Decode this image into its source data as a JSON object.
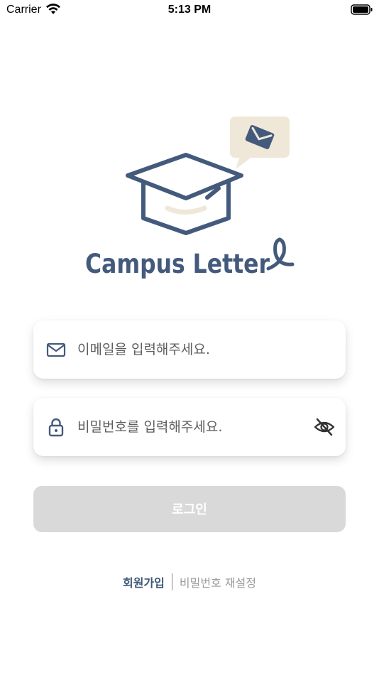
{
  "status_bar": {
    "carrier": "Carrier",
    "time": "5:13 PM"
  },
  "logo": {
    "brand_text": "Campus Letter",
    "icon": "graduation-cap-with-letter-logo"
  },
  "form": {
    "email": {
      "icon": "mail-icon",
      "placeholder": "이메일을 입력해주세요.",
      "value": ""
    },
    "password": {
      "icon": "lock-icon",
      "placeholder": "비밀번호를 입력해주세요.",
      "value": "",
      "toggle_icon": "eye-off-icon"
    },
    "login_label": "로그인"
  },
  "links": {
    "signup": "회원가입",
    "reset_password": "비밀번호 재설정"
  },
  "colors": {
    "brand_navy": "#445a7c",
    "accent_beige": "#efe8d8",
    "button_disabled": "#d9d9d9"
  }
}
